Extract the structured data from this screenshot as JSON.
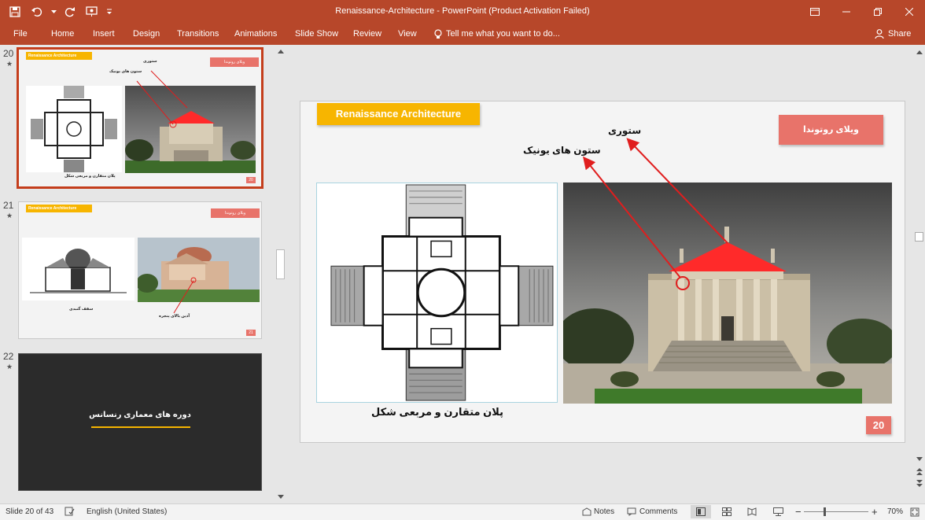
{
  "window": {
    "title": "Renaissance-Architecture - PowerPoint (Product Activation Failed)"
  },
  "ribbon": {
    "tabs": [
      "File",
      "Home",
      "Insert",
      "Design",
      "Transitions",
      "Animations",
      "Slide Show",
      "Review",
      "View"
    ],
    "tell_me": "Tell me what you want to do...",
    "share": "Share"
  },
  "thumbnails": [
    {
      "number": "20",
      "title": "Renaissance Architecture",
      "badge": "ویلای روتوندا",
      "label_pediment": "ستوری",
      "label_columns": "ستون های یونیک",
      "caption": "پلان متقارن و مربعی شکل",
      "slide_number": "20"
    },
    {
      "number": "21",
      "title": "Renaissance Architecture",
      "badge": "ویلای روتوندا",
      "caption_left": "سقف گنبدی",
      "caption_right": "آذین بالای پنجره",
      "slide_number": "21"
    },
    {
      "number": "22",
      "title": "دوره های معماری رنسانس"
    }
  ],
  "slide": {
    "title": "Renaissance Architecture",
    "badge": "ویلای روتوندا",
    "label_pediment": "ستوری",
    "label_columns": "ستون های یونیک",
    "caption": "پلان متقارن و مربعی شکل",
    "slide_number": "20"
  },
  "status": {
    "slide_info": "Slide 20 of 43",
    "language": "English (United States)",
    "notes": "Notes",
    "comments": "Comments",
    "zoom": "70%"
  },
  "colors": {
    "ribbon": "#b7472a",
    "title_box": "#f7b500",
    "badge": "#e8736a",
    "arrow": "#e01e1e"
  }
}
